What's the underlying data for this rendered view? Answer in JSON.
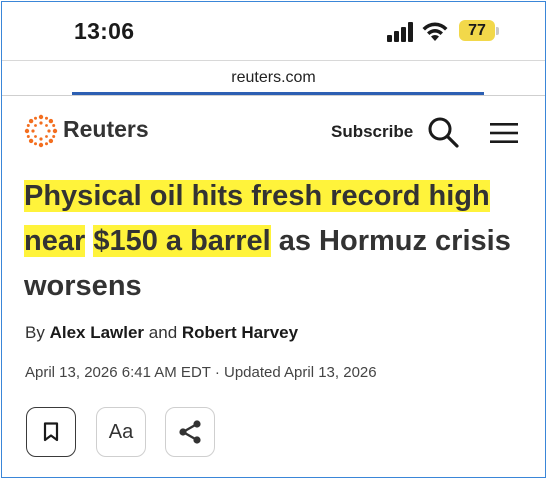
{
  "status_bar": {
    "time": "13:06",
    "battery_level": "77",
    "icons": [
      "signal-icon",
      "wifi-icon",
      "battery-icon"
    ]
  },
  "browser": {
    "url": "reuters.com"
  },
  "header": {
    "logo_text": "Reuters",
    "subscribe_label": "Subscribe",
    "icons": [
      "reuters-logo-icon",
      "search-icon",
      "menu-icon"
    ]
  },
  "article": {
    "headline_highlight_1": "Physical oil hits fresh record high near",
    "headline_highlight_2": "$150 a barrel",
    "headline_rest": " as Hormuz crisis worsens",
    "byline_prefix": "By ",
    "author_1": "Alex Lawler",
    "byline_and": " and ",
    "author_2": "Robert Harvey",
    "dateline": "April 13, 2026 6:41 AM EDT · Updated April 13, 2026"
  },
  "actions": {
    "text_size_label": "Aa",
    "icons": [
      "bookmark-icon",
      "share-icon"
    ]
  },
  "colors": {
    "highlight": "#fff33b",
    "battery": "#f2d84a",
    "frame_border": "#3a86d8",
    "logo_orange": "#f36e1f"
  }
}
